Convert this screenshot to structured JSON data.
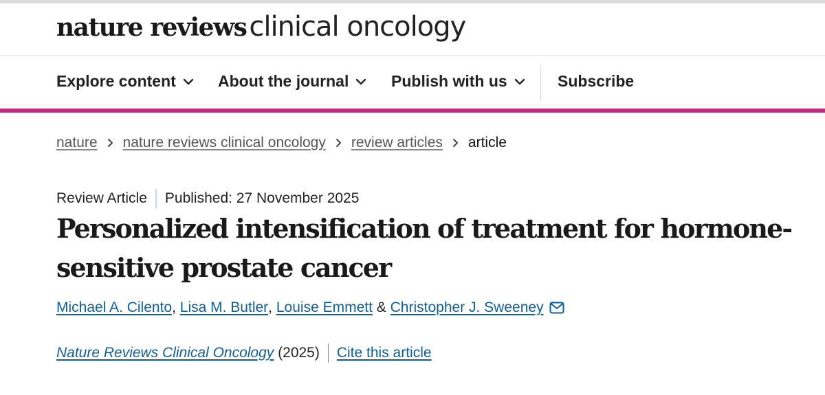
{
  "masthead": {
    "brand_bold": "nature reviews",
    "brand_light": "clinical oncology"
  },
  "nav": {
    "items": [
      {
        "label": "Explore content",
        "icon": "chevron-down-icon"
      },
      {
        "label": "About the journal",
        "icon": "chevron-down-icon"
      },
      {
        "label": "Publish with us",
        "icon": "chevron-down-icon"
      },
      {
        "label": "Subscribe"
      }
    ]
  },
  "colors": {
    "accent": "#c42a80",
    "link": "#0f5e99",
    "text": "#222222"
  },
  "breadcrumb": {
    "items": [
      "nature",
      "nature reviews clinical oncology",
      "review articles"
    ],
    "current": "article",
    "separator_icon": "chevron-right-icon"
  },
  "article": {
    "type": "Review Article",
    "published": "Published: 27 November 2025",
    "title_line1": "Personalized intensification of treatment for hormone-",
    "title_line2": "sensitive prostate cancer",
    "authors": [
      "Michael A. Cilento",
      "Lisa M. Butler",
      "Louise Emmett",
      "Christopher J. Sweeney"
    ],
    "author_seps": [
      ",",
      ",",
      "&"
    ],
    "mail_icon": "mail-icon",
    "journal": "Nature Reviews Clinical Oncology",
    "year": "(2025)",
    "cite_label": "Cite this article"
  }
}
